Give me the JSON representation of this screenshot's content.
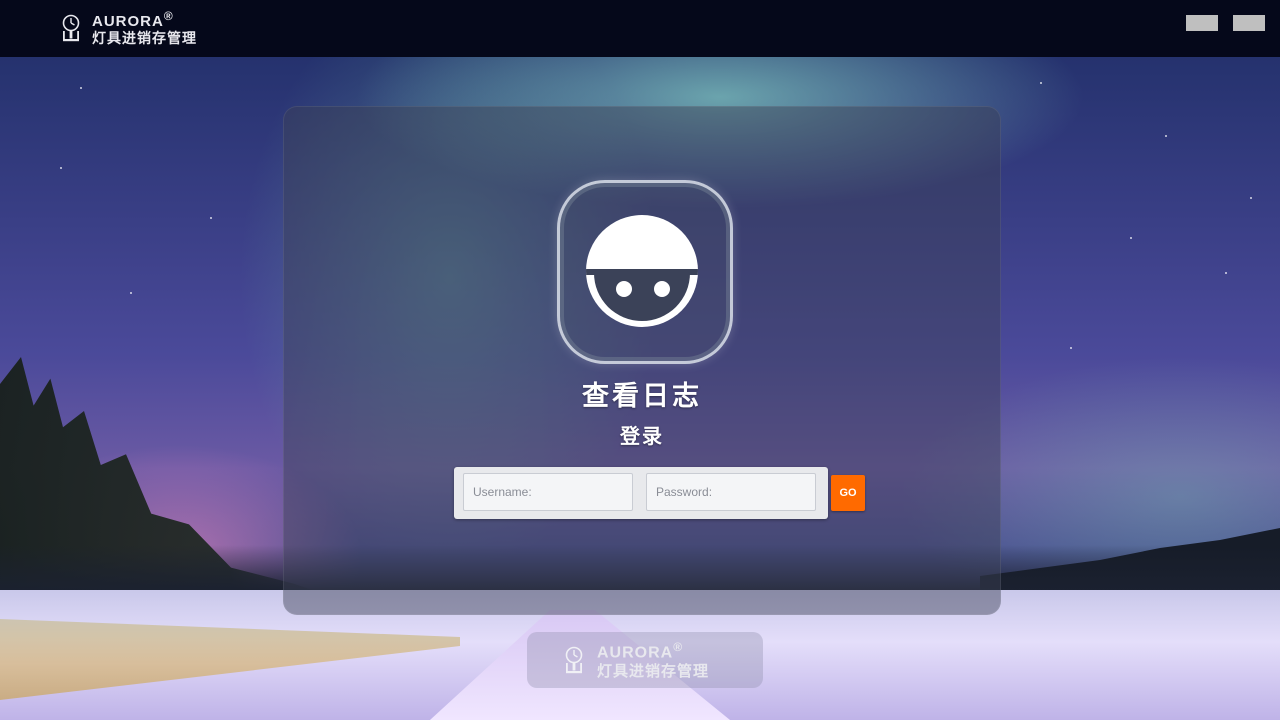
{
  "header": {
    "brand": {
      "name": "AURORA",
      "registered": "®",
      "subtitle": "灯具进销存管理"
    },
    "buttons": [
      "",
      ""
    ]
  },
  "login": {
    "avatar_icon": "user-avatar-icon",
    "title": "查看日志",
    "subtitle": "登录",
    "username_placeholder": "Username:",
    "username_value": "",
    "password_placeholder": "Password:",
    "password_value": "",
    "submit_label": "GO"
  },
  "footer": {
    "brand": {
      "name": "AURORA",
      "registered": "®",
      "subtitle": "灯具进销存管理"
    }
  },
  "colors": {
    "topbar": "#05081a",
    "accent": "#ff6a00",
    "text": "#ffffff"
  }
}
